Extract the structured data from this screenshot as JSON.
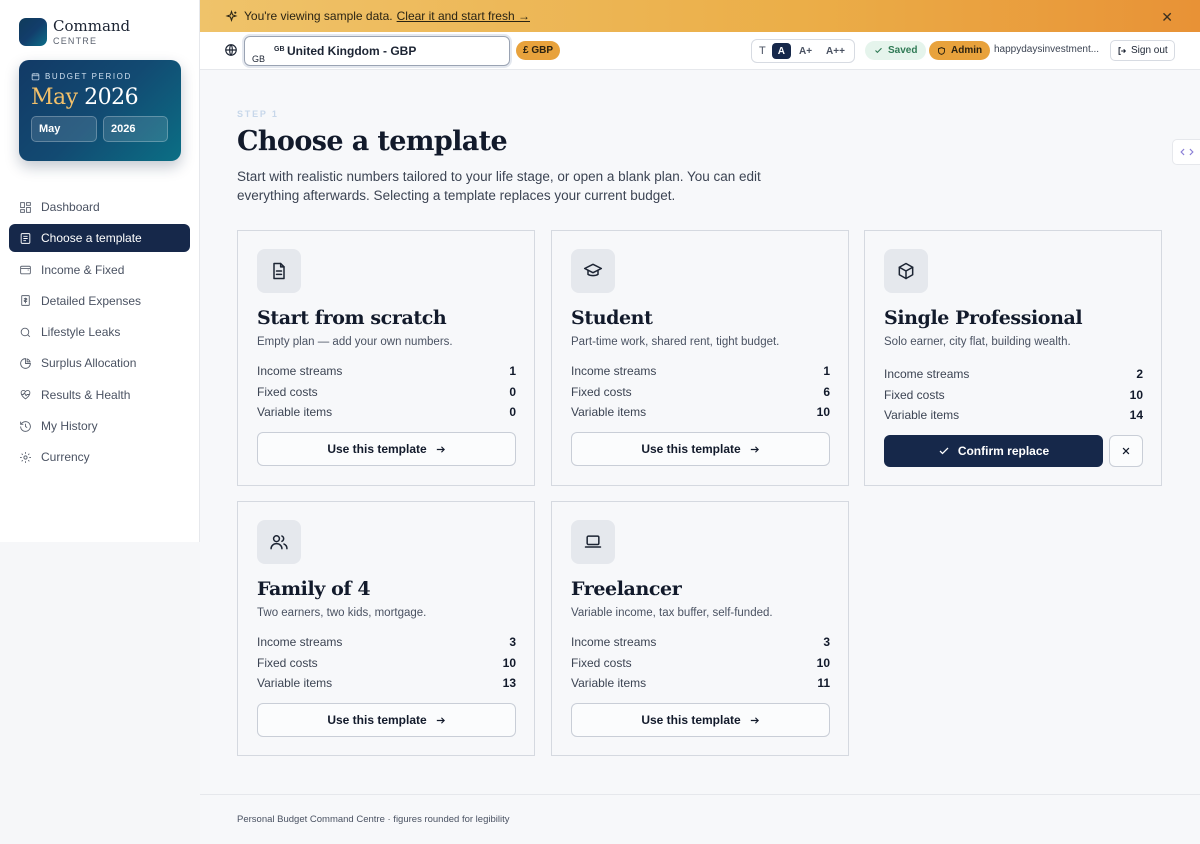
{
  "brand": {
    "title": "Command",
    "subtitle": "CENTRE"
  },
  "budget_period": {
    "label": "BUDGET PERIOD",
    "month": "May",
    "year": "2026",
    "month_select": "May",
    "year_select": "2026"
  },
  "nav": [
    {
      "label": "Dashboard",
      "icon": "dashboard-icon"
    },
    {
      "label": "Choose a template",
      "icon": "template-icon",
      "active": true
    },
    {
      "label": "Income & Fixed",
      "icon": "wallet-icon"
    },
    {
      "label": "Detailed Expenses",
      "icon": "receipt-icon"
    },
    {
      "label": "Lifestyle Leaks",
      "icon": "search-icon"
    },
    {
      "label": "Surplus Allocation",
      "icon": "pie-icon"
    },
    {
      "label": "Results & Health",
      "icon": "heart-pulse-icon"
    },
    {
      "label": "My History",
      "icon": "history-icon"
    },
    {
      "label": "Currency",
      "icon": "gear-icon"
    }
  ],
  "banner": {
    "text": "You're viewing sample data.",
    "link": "Clear it and start fresh →"
  },
  "topbar": {
    "country_flag": "GB",
    "country_code": "GB",
    "country": "United Kingdom - GBP",
    "currency": "£ GBP",
    "font_sizes": [
      "A",
      "A+",
      "A++"
    ],
    "saved": "Saved",
    "admin": "Admin",
    "email": "happydaysinvestment...",
    "sign_out": "Sign out"
  },
  "page": {
    "step": "STEP 1",
    "title": "Choose a template",
    "description": "Start with realistic numbers tailored to your life stage, or open a blank plan. You can edit everything afterwards. Selecting a template replaces your current budget."
  },
  "stat_labels": {
    "income": "Income streams",
    "fixed": "Fixed costs",
    "variable": "Variable items"
  },
  "templates": [
    {
      "title": "Start from scratch",
      "subtitle": "Empty plan — add your own numbers.",
      "income": "1",
      "fixed": "0",
      "variable": "0",
      "button": "Use this template",
      "icon": "document-icon"
    },
    {
      "title": "Student",
      "subtitle": "Part-time work, shared rent, tight budget.",
      "income": "1",
      "fixed": "6",
      "variable": "10",
      "button": "Use this template",
      "icon": "graduation-cap-icon"
    },
    {
      "title": "Single Professional",
      "subtitle": "Solo earner, city flat, building wealth.",
      "income": "2",
      "fixed": "10",
      "variable": "14",
      "button": "Confirm replace",
      "icon": "box-icon"
    },
    {
      "title": "Family of 4",
      "subtitle": "Two earners, two kids, mortgage.",
      "income": "3",
      "fixed": "10",
      "variable": "13",
      "button": "Use this template",
      "icon": "users-icon"
    },
    {
      "title": "Freelancer",
      "subtitle": "Variable income, tax buffer, self-funded.",
      "income": "3",
      "fixed": "10",
      "variable": "11",
      "button": "Use this template",
      "icon": "laptop-icon"
    }
  ],
  "footer": "Personal Budget Command Centre · figures rounded for legibility"
}
